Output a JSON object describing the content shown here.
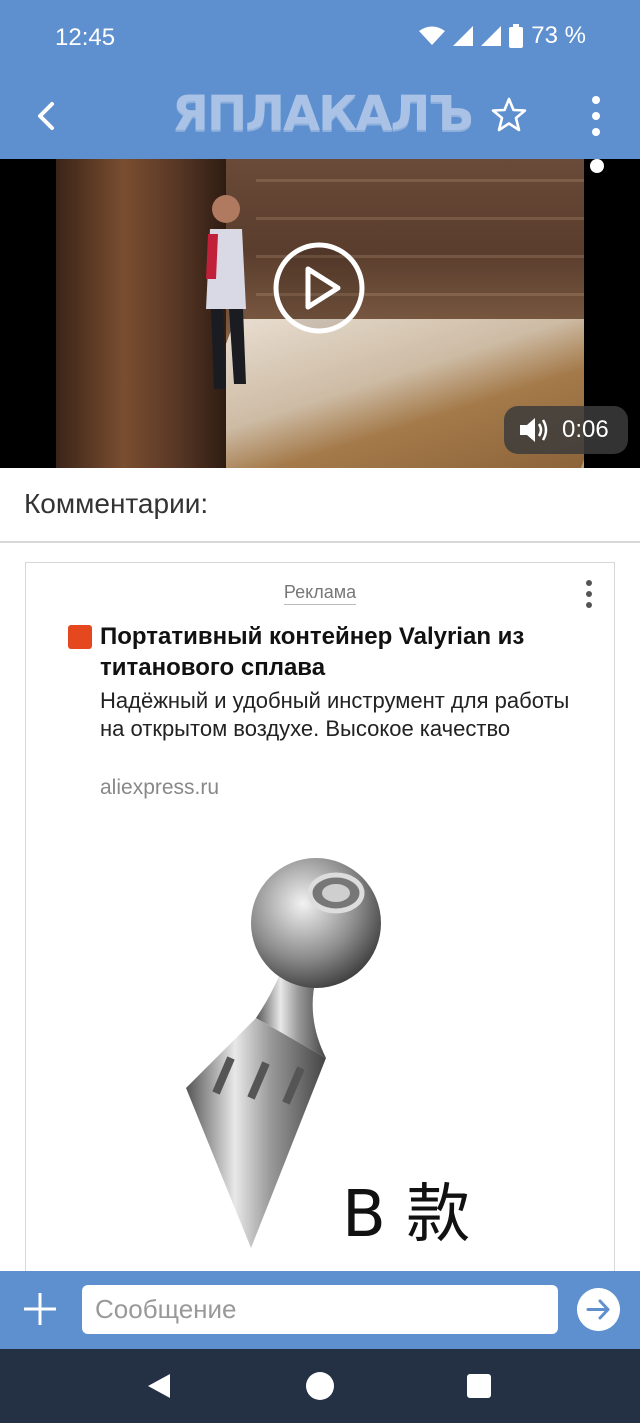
{
  "status_bar": {
    "time": "12:45",
    "battery": "73 %"
  },
  "app_bar": {
    "logo": "ЯПЛАКАЛЪ"
  },
  "video": {
    "duration": "0:06"
  },
  "comments": {
    "title": "Комментарии:"
  },
  "ad": {
    "label": "Реклама",
    "title": "Портативный контейнер Valyrian из титанового сплава",
    "description": "Надёжный и удобный инструмент для работы на открытом воздухе. Высокое качество",
    "domain": "aliexpress.ru",
    "image_caption": "B 款"
  },
  "message_bar": {
    "placeholder": "Сообщение"
  }
}
